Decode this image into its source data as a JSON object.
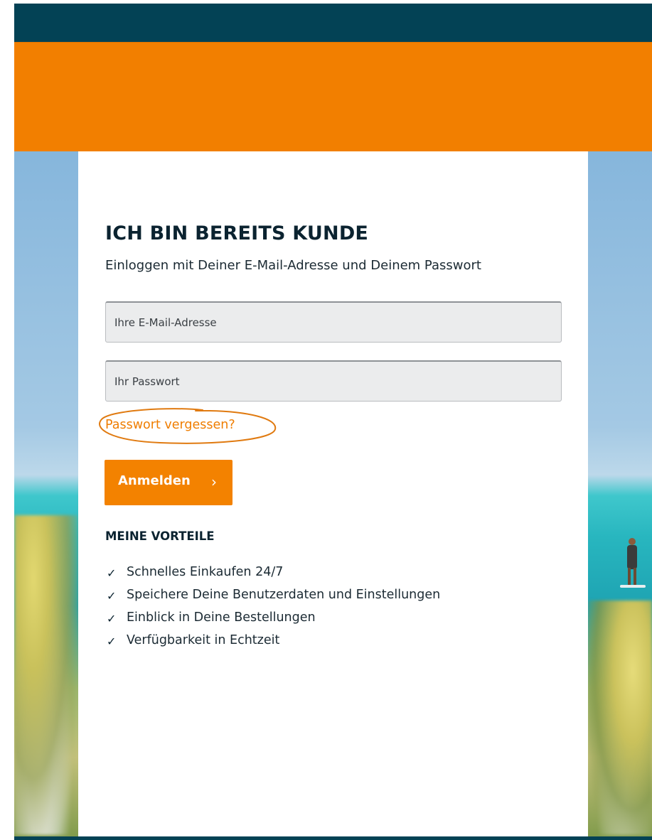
{
  "login": {
    "title": "ICH BIN BEREITS KUNDE",
    "subtitle": "Einloggen mit Deiner E-Mail-Adresse und Deinem Passwort",
    "email_placeholder": "Ihre E-Mail-Adresse",
    "password_placeholder": "Ihr Passwort",
    "forgot_label": "Passwort vergessen?",
    "submit_label": "Anmelden",
    "submit_chevron": "›"
  },
  "benefits": {
    "title": "MEINE VORTEILE",
    "check_glyph": "✓",
    "items": [
      "Schnelles Einkaufen 24/7",
      "Speichere Deine Benutzerdaten und Einstellungen",
      "Einblick in Deine Bestellungen",
      "Verfügbarkeit in Echtzeit"
    ]
  },
  "colors": {
    "brand_dark": "#034255",
    "brand_orange": "#f27f00",
    "annotation_orange": "#e07a10"
  }
}
